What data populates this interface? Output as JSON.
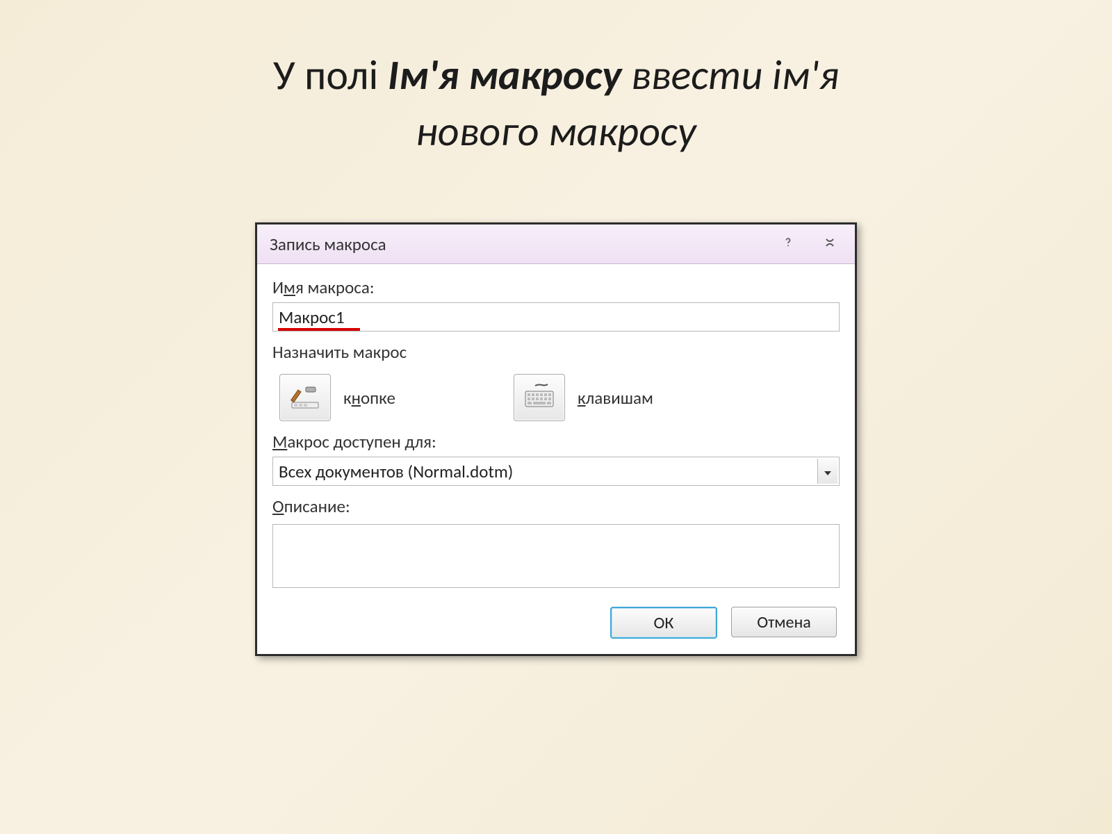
{
  "heading": {
    "line1_a": "У полі ",
    "line1_b": "Ім'я макросу",
    "line1_c": " ввести ім'я",
    "line2": "нового макросу"
  },
  "dialog": {
    "title": "Запись макроса",
    "name_label_pre": "И",
    "name_label_ul": "м",
    "name_label_post": "я макроса:",
    "name_value": "Макрос1",
    "assign_section": "Назначить макрос",
    "assign_button_pre": "к",
    "assign_button_ul": "н",
    "assign_button_post": "опке",
    "assign_keys_ul": "к",
    "assign_keys_post": "лавишам",
    "available_ul": "М",
    "available_post": "акрос доступен для:",
    "available_value": "Всех документов (Normal.dotm)",
    "desc_ul": "О",
    "desc_post": "писание:",
    "desc_value": "",
    "ok": "ОК",
    "cancel": "Отмена"
  }
}
